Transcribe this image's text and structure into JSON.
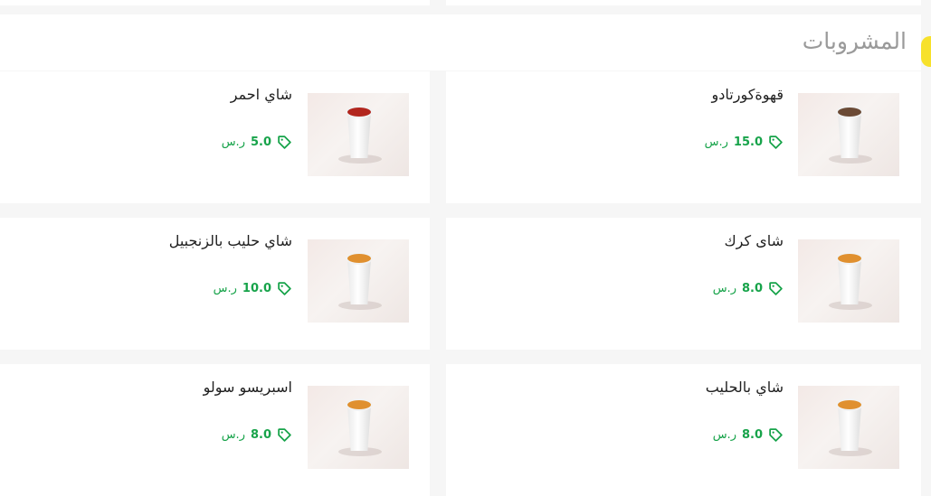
{
  "section": {
    "title": "المشروبات"
  },
  "colors": {
    "accent": "#f7e12b",
    "price": "#17a34a"
  },
  "currency": "ر.س",
  "products": [
    {
      "name": "قهوةكورتادو",
      "price": "15.0",
      "cup_color": "#6b4a35"
    },
    {
      "name": "شاي احمر",
      "price": "5.0",
      "cup_color": "#b2261e"
    },
    {
      "name": "شاى كرك",
      "price": "8.0",
      "cup_color": "#e0902f"
    },
    {
      "name": "شاي حليب بالزنجبيل",
      "price": "10.0",
      "cup_color": "#e0902f"
    },
    {
      "name": "شاي بالحليب",
      "price": "8.0",
      "cup_color": "#e0902f"
    },
    {
      "name": "اسبريسو سولو",
      "price": "8.0",
      "cup_color": "#e0902f"
    }
  ]
}
